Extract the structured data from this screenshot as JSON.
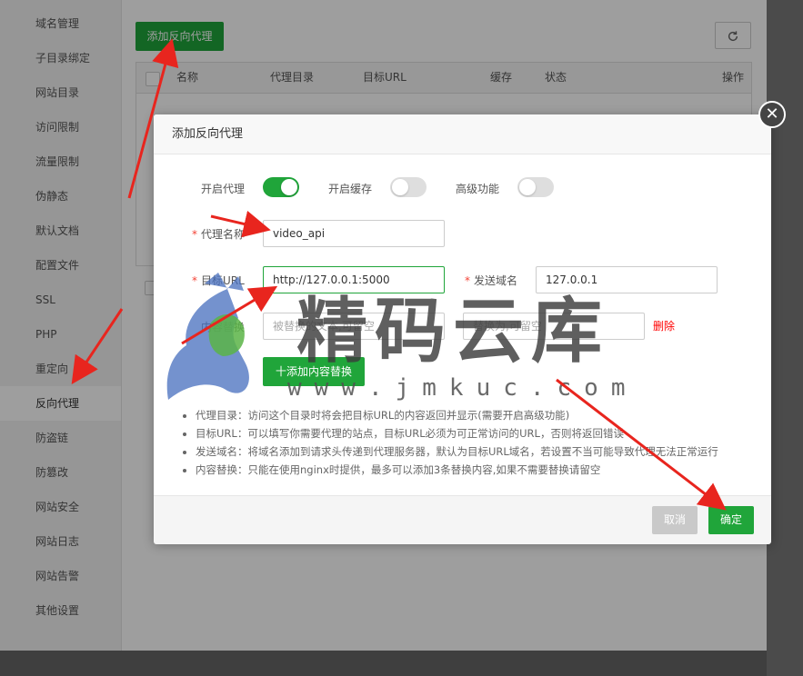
{
  "sidebar": {
    "items": [
      {
        "label": "域名管理"
      },
      {
        "label": "子目录绑定"
      },
      {
        "label": "网站目录"
      },
      {
        "label": "访问限制"
      },
      {
        "label": "流量限制"
      },
      {
        "label": "伪静态"
      },
      {
        "label": "默认文档"
      },
      {
        "label": "配置文件"
      },
      {
        "label": "SSL"
      },
      {
        "label": "PHP"
      },
      {
        "label": "重定向"
      },
      {
        "label": "反向代理",
        "active": true
      },
      {
        "label": "防盗链"
      },
      {
        "label": "防篡改"
      },
      {
        "label": "网站安全"
      },
      {
        "label": "网站日志"
      },
      {
        "label": "网站告警"
      },
      {
        "label": "其他设置"
      }
    ]
  },
  "main": {
    "add_button": "添加反向代理",
    "refresh_icon": "refresh-icon",
    "table": {
      "columns": [
        "名称",
        "代理目录",
        "目标URL",
        "缓存",
        "状态",
        "操作"
      ]
    }
  },
  "modal": {
    "title": "添加反向代理",
    "close_icon": "close-icon",
    "toggles": {
      "proxy": {
        "label": "开启代理",
        "on": true
      },
      "cache": {
        "label": "开启缓存",
        "on": false
      },
      "advanced": {
        "label": "高级功能",
        "on": false
      }
    },
    "fields": {
      "name": {
        "label": "代理名称",
        "value": "video_api"
      },
      "target_url": {
        "label": "目标URL",
        "value": "http://127.0.0.1:5000"
      },
      "send_domain": {
        "label": "发送域名",
        "value": "127.0.0.1"
      },
      "replace": {
        "label": "内容替换",
        "from_placeholder": "被替换的文本,可留空",
        "to_placeholder": "替换为,可留空",
        "delete_label": "删除"
      }
    },
    "add_replace_button": "十添加内容替换",
    "tips": [
      "代理目录：访问这个目录时将会把目标URL的内容返回并显示(需要开启高级功能)",
      "目标URL：可以填写你需要代理的站点，目标URL必须为可正常访问的URL，否则将返回错误",
      "发送域名：将域名添加到请求头传递到代理服务器，默认为目标URL域名，若设置不当可能导致代理无法正常运行",
      "内容替换：只能在使用nginx时提供，最多可以添加3条替换内容,如果不需要替换请留空"
    ],
    "footer": {
      "cancel": "取消",
      "confirm": "确定"
    }
  },
  "watermark": {
    "text": "精码云库",
    "url": "www.jmkuc.com"
  },
  "colors": {
    "accent": "#20a53a",
    "annotation_arrow": "#e8251e",
    "danger": "#ff0000"
  }
}
